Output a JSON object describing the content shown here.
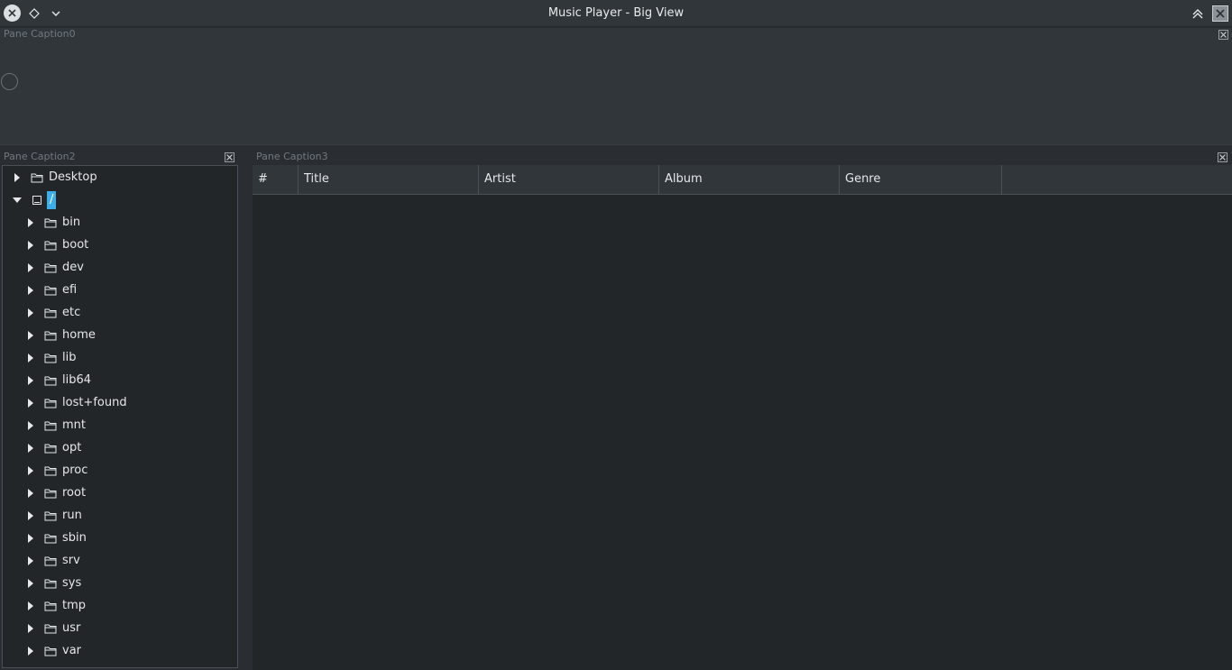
{
  "window": {
    "title": "Music Player - Big View"
  },
  "panes": {
    "top_caption": "Pane Caption0",
    "left_caption": "Pane Caption2",
    "right_caption": "Pane Caption3"
  },
  "tree": {
    "items": [
      {
        "label": "Desktop",
        "level": 0,
        "expanded": false,
        "icon": "folder-icon"
      },
      {
        "label": "/",
        "level": 0,
        "expanded": true,
        "icon": "drive-icon",
        "selected": true
      },
      {
        "label": "bin",
        "level": 1,
        "expanded": false,
        "icon": "folder-icon"
      },
      {
        "label": "boot",
        "level": 1,
        "expanded": false,
        "icon": "folder-icon"
      },
      {
        "label": "dev",
        "level": 1,
        "expanded": false,
        "icon": "folder-icon"
      },
      {
        "label": "efi",
        "level": 1,
        "expanded": false,
        "icon": "folder-icon"
      },
      {
        "label": "etc",
        "level": 1,
        "expanded": false,
        "icon": "folder-icon"
      },
      {
        "label": "home",
        "level": 1,
        "expanded": false,
        "icon": "folder-icon"
      },
      {
        "label": "lib",
        "level": 1,
        "expanded": false,
        "icon": "folder-icon"
      },
      {
        "label": "lib64",
        "level": 1,
        "expanded": false,
        "icon": "folder-icon"
      },
      {
        "label": "lost+found",
        "level": 1,
        "expanded": false,
        "icon": "folder-icon"
      },
      {
        "label": "mnt",
        "level": 1,
        "expanded": false,
        "icon": "folder-icon"
      },
      {
        "label": "opt",
        "level": 1,
        "expanded": false,
        "icon": "folder-icon"
      },
      {
        "label": "proc",
        "level": 1,
        "expanded": false,
        "icon": "folder-icon"
      },
      {
        "label": "root",
        "level": 1,
        "expanded": false,
        "icon": "folder-icon"
      },
      {
        "label": "run",
        "level": 1,
        "expanded": false,
        "icon": "folder-icon"
      },
      {
        "label": "sbin",
        "level": 1,
        "expanded": false,
        "icon": "folder-icon"
      },
      {
        "label": "srv",
        "level": 1,
        "expanded": false,
        "icon": "folder-icon"
      },
      {
        "label": "sys",
        "level": 1,
        "expanded": false,
        "icon": "folder-icon"
      },
      {
        "label": "tmp",
        "level": 1,
        "expanded": false,
        "icon": "folder-icon"
      },
      {
        "label": "usr",
        "level": 1,
        "expanded": false,
        "icon": "folder-icon"
      },
      {
        "label": "var",
        "level": 1,
        "expanded": false,
        "icon": "folder-icon"
      }
    ]
  },
  "playlist": {
    "columns": [
      "#",
      "Title",
      "Artist",
      "Album",
      "Genre"
    ]
  },
  "colors": {
    "selection": "#3daee9",
    "background": "#232629",
    "panel": "#31363b"
  }
}
